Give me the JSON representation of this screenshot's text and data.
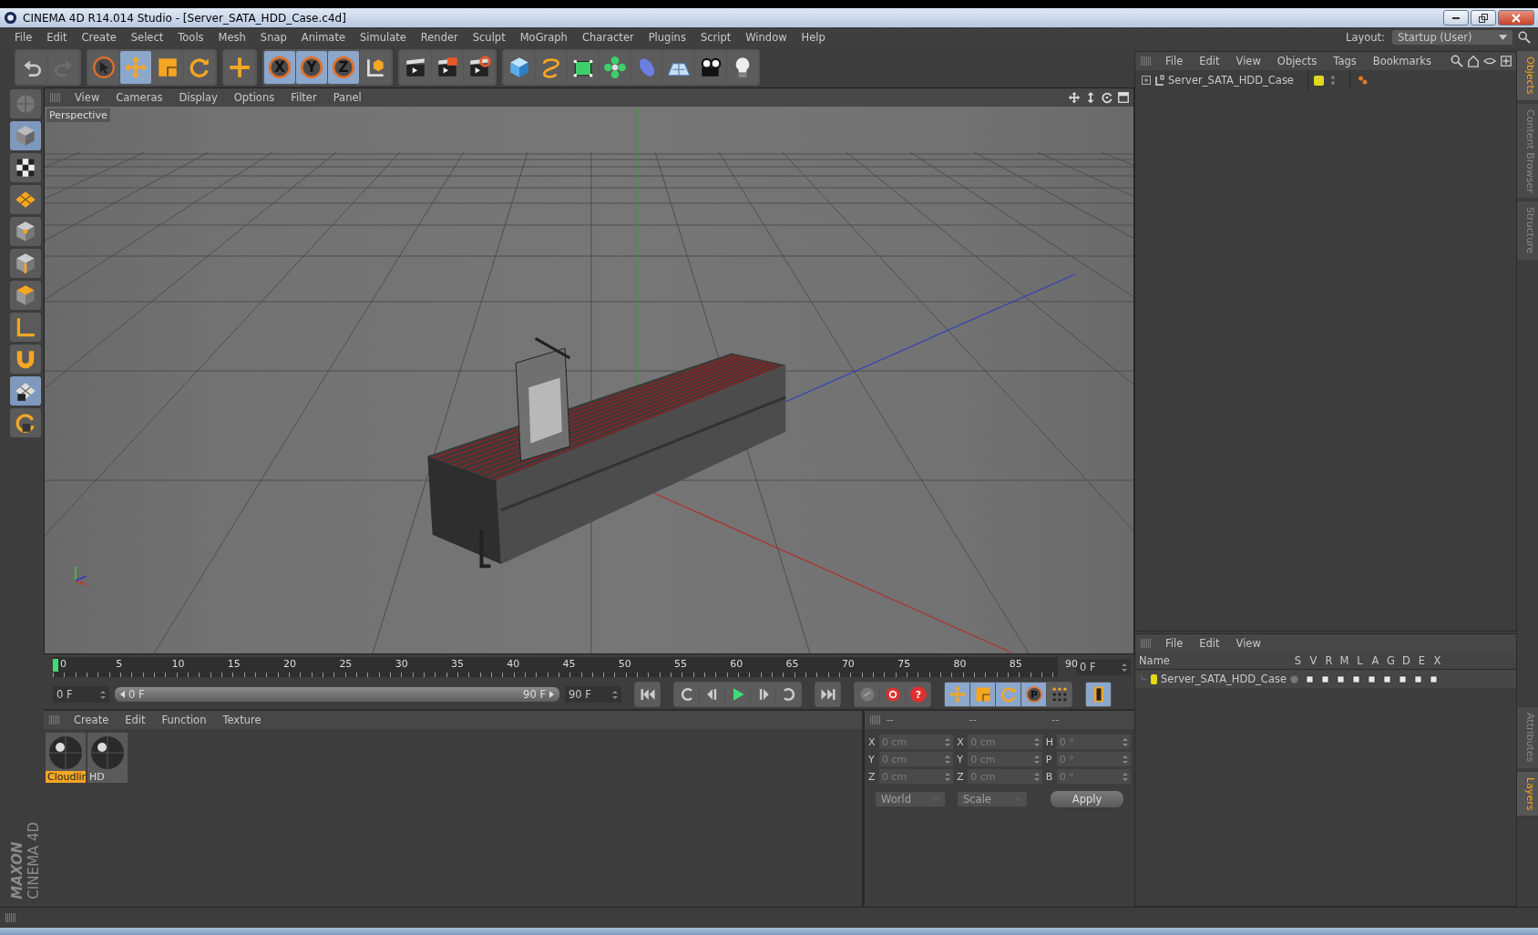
{
  "window": {
    "title": "CINEMA 4D R14.014 Studio - [Server_SATA_HDD_Case.c4d]"
  },
  "menu": [
    "File",
    "Edit",
    "Create",
    "Select",
    "Tools",
    "Mesh",
    "Snap",
    "Animate",
    "Simulate",
    "Render",
    "Sculpt",
    "MoGraph",
    "Character",
    "Plugins",
    "Script",
    "Window",
    "Help"
  ],
  "layout": {
    "label": "Layout:",
    "value": "Startup (User)"
  },
  "toolbar": {
    "groups": [
      [
        {
          "kind": "undo",
          "selected": false
        },
        {
          "kind": "redo",
          "selected": false
        }
      ],
      [
        {
          "kind": "select",
          "selected": false
        },
        {
          "kind": "move",
          "selected": true
        },
        {
          "kind": "scale",
          "selected": false
        },
        {
          "kind": "rotate",
          "selected": false
        }
      ],
      [
        {
          "kind": "add",
          "selected": false
        }
      ],
      [
        {
          "kind": "axis",
          "label": "X",
          "selected": true
        },
        {
          "kind": "axis",
          "label": "Y",
          "selected": true
        },
        {
          "kind": "axis",
          "label": "Z",
          "selected": true
        },
        {
          "kind": "coord",
          "selected": false
        }
      ],
      [
        {
          "kind": "render-view",
          "selected": false
        },
        {
          "kind": "render-picture",
          "selected": false
        },
        {
          "kind": "render-settings",
          "selected": false
        }
      ],
      [
        {
          "kind": "cube",
          "selected": false
        },
        {
          "kind": "spline",
          "selected": false
        },
        {
          "kind": "nurbs",
          "selected": false
        },
        {
          "kind": "cloner",
          "selected": false
        },
        {
          "kind": "deformer",
          "selected": false
        },
        {
          "kind": "floor",
          "selected": false
        },
        {
          "kind": "camera",
          "selected": false
        },
        {
          "kind": "light",
          "selected": false
        }
      ]
    ]
  },
  "left_toolbar": [
    {
      "kind": "sphere",
      "selected": false
    },
    {
      "kind": "model",
      "selected": true
    },
    {
      "kind": "texture",
      "selected": false
    },
    {
      "kind": "workplane",
      "selected": false
    },
    {
      "kind": "points",
      "selected": false
    },
    {
      "kind": "edges",
      "selected": false
    },
    {
      "kind": "polygons",
      "selected": false
    },
    {
      "kind": "axis",
      "selected": false
    },
    {
      "kind": "magnet",
      "selected": false
    },
    {
      "kind": "grid",
      "selected": true
    },
    {
      "kind": "lock",
      "selected": false
    }
  ],
  "viewport": {
    "menu": [
      "View",
      "Cameras",
      "Display",
      "Options",
      "Filter",
      "Panel"
    ],
    "label": "Perspective"
  },
  "objects_panel": {
    "menu": [
      "File",
      "Edit",
      "View",
      "Objects",
      "Tags",
      "Bookmarks"
    ],
    "objects": [
      {
        "name": "Server_SATA_HDD_Case",
        "color": "#e2d81c"
      }
    ]
  },
  "side_tabs_top": [
    {
      "label": "Objects",
      "selected": true
    },
    {
      "label": "Content Browser",
      "selected": false
    },
    {
      "label": "Structure",
      "selected": false
    }
  ],
  "side_tabs_bottom": [
    {
      "label": "Attributes",
      "selected": false
    },
    {
      "label": "Layers",
      "selected": true
    }
  ],
  "timeline": {
    "ticks": [
      "0",
      "5",
      "10",
      "15",
      "20",
      "25",
      "30",
      "35",
      "40",
      "45",
      "50",
      "55",
      "60",
      "65",
      "70",
      "75",
      "80",
      "85",
      "90"
    ],
    "current": "0 F",
    "start": "0 F",
    "range_start": "0 F",
    "range_end": "90 F",
    "end": "90 F",
    "level": 1
  },
  "playback": {
    "groups": [
      [
        {
          "kind": "first",
          "selected": false
        }
      ],
      [
        {
          "kind": "loop-back",
          "selected": false
        },
        {
          "kind": "prev",
          "selected": false
        },
        {
          "kind": "play",
          "selected": false
        },
        {
          "kind": "next",
          "selected": false
        },
        {
          "kind": "loop-forward",
          "selected": false
        }
      ],
      [
        {
          "kind": "last",
          "selected": false
        }
      ],
      [
        {
          "kind": "keyframe",
          "selected": false
        },
        {
          "kind": "record",
          "selected": false
        },
        {
          "kind": "help",
          "label": "?",
          "selected": false
        }
      ],
      [
        {
          "kind": "move",
          "selected": true
        },
        {
          "kind": "scale",
          "selected": true
        },
        {
          "kind": "rotate",
          "selected": true
        },
        {
          "kind": "param",
          "label": "P",
          "selected": true
        },
        {
          "kind": "points-grid",
          "selected": false
        }
      ],
      [
        {
          "kind": "film",
          "selected": true
        }
      ]
    ]
  },
  "materials": {
    "menu": [
      "Create",
      "Edit",
      "Function",
      "Texture"
    ],
    "items": [
      {
        "name": "Cloudlir",
        "selected": true
      },
      {
        "name": "HD",
        "selected": false
      }
    ]
  },
  "coordinates": {
    "headers": [
      "--",
      "--",
      "--"
    ],
    "columns": [
      [
        {
          "axis": "X",
          "value": "0 cm"
        },
        {
          "axis": "Y",
          "value": "0 cm"
        },
        {
          "axis": "Z",
          "value": "0 cm"
        }
      ],
      [
        {
          "axis": "X",
          "value": "0 cm"
        },
        {
          "axis": "Y",
          "value": "0 cm"
        },
        {
          "axis": "Z",
          "value": "0 cm"
        }
      ],
      [
        {
          "axis": "H",
          "value": "0 °"
        },
        {
          "axis": "P",
          "value": "0 °"
        },
        {
          "axis": "B",
          "value": "0 °"
        }
      ]
    ],
    "dropdowns": [
      "World",
      "Scale"
    ],
    "apply": "Apply"
  },
  "layers_panel": {
    "menu": [
      "File",
      "Edit",
      "View"
    ],
    "columns": [
      "Name",
      "S",
      "V",
      "R",
      "M",
      "L",
      "A",
      "G",
      "D",
      "E",
      "X"
    ],
    "layers": [
      {
        "name": "Server_SATA_HDD_Case",
        "color": "#e2d81c"
      }
    ]
  },
  "logo": {
    "brand": "MAXON",
    "product": "CINEMA 4D"
  }
}
